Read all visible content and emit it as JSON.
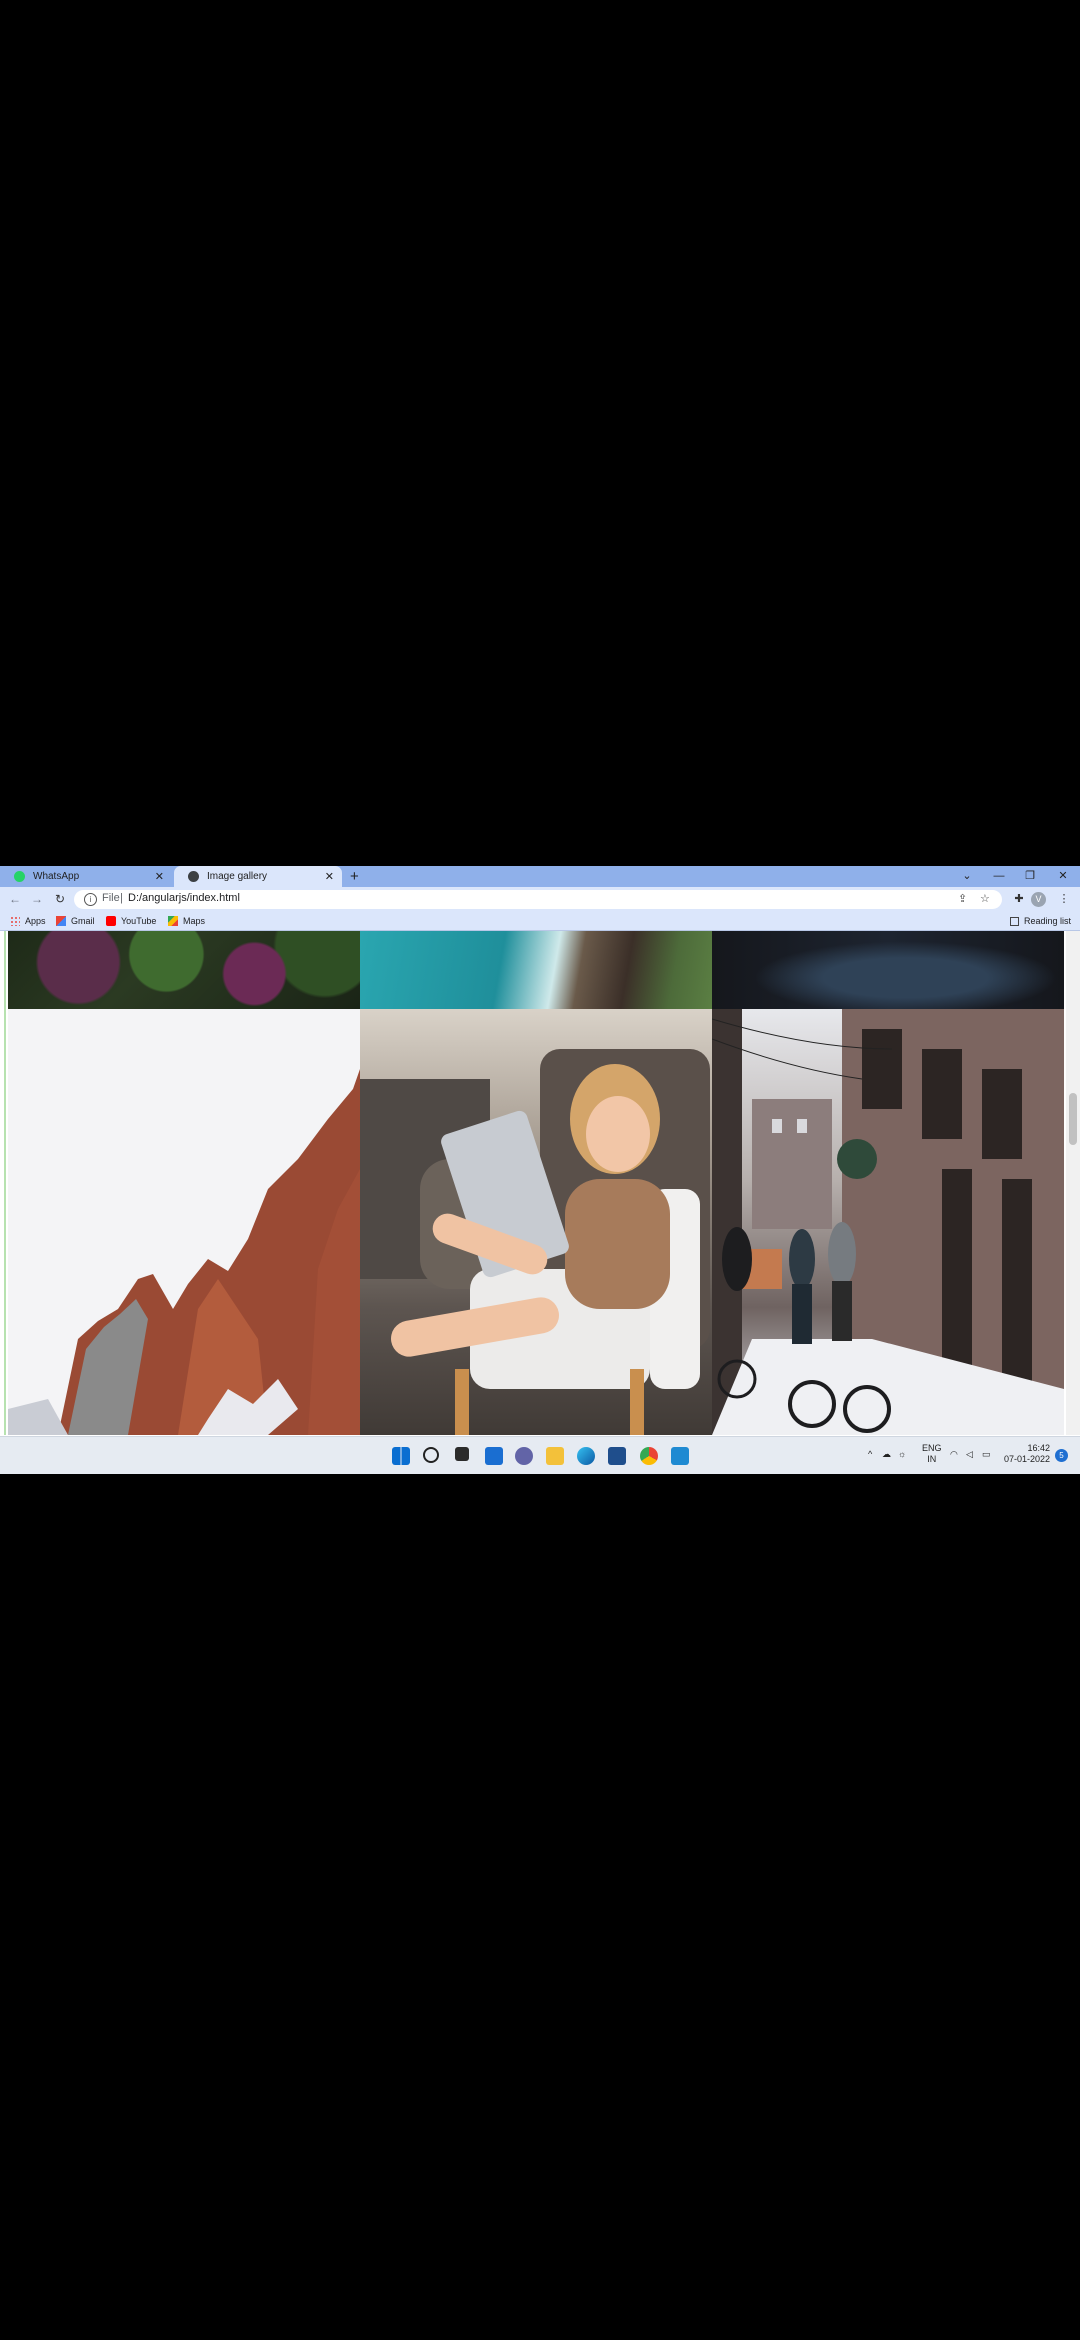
{
  "tabs": [
    {
      "label": "WhatsApp",
      "active": false
    },
    {
      "label": "Image gallery",
      "active": true
    }
  ],
  "window_controls": {
    "minimize": "—",
    "maximize": "❐",
    "close": "✕",
    "dropdown": "⌄"
  },
  "address_bar": {
    "scheme_label": "File",
    "url": "D:/angularjs/index.html"
  },
  "profile_initial": "V",
  "bookmarks": [
    {
      "label": "Apps",
      "icon": "apps-grid-icon"
    },
    {
      "label": "Gmail",
      "icon": "gmail-icon"
    },
    {
      "label": "YouTube",
      "icon": "youtube-icon"
    },
    {
      "label": "Maps",
      "icon": "maps-icon"
    }
  ],
  "reading_list": "Reading list",
  "gallery": {
    "images": [
      {
        "name": "plants-photo",
        "description": "dark green and purple leaves"
      },
      {
        "name": "ocean-cliffs-photo",
        "description": "aerial turquoise sea and rocks"
      },
      {
        "name": "dark-photo",
        "description": "dark blue scene"
      },
      {
        "name": "mountain-photo",
        "description": "red rock peaks"
      },
      {
        "name": "child-tablet-photo",
        "description": "child on chair with tablet"
      },
      {
        "name": "snowy-street-photo",
        "description": "snowy street with people and bicycles"
      }
    ]
  },
  "taskbar": {
    "tray_language": "ENG",
    "tray_region": "IN",
    "time": "16:42",
    "date": "07-01-2022",
    "notification_count": "5"
  },
  "colors": {
    "accent": "#1a73e8",
    "titlebar": "#8fb0ea",
    "toolbar": "#dbe6fb"
  }
}
